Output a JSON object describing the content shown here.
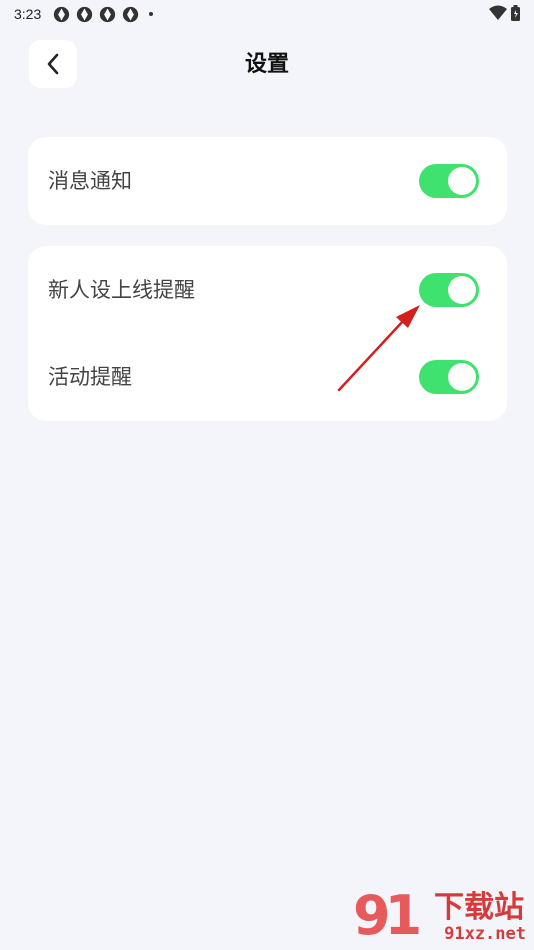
{
  "status_bar": {
    "time": "3:23"
  },
  "header": {
    "title": "设置"
  },
  "settings": [
    {
      "label": "消息通知",
      "enabled": true
    },
    {
      "label": "新人设上线提醒",
      "enabled": true
    },
    {
      "label": "活动提醒",
      "enabled": true
    }
  ],
  "colors": {
    "background": "#f4f5fa",
    "toggle_on": "#3fe26f",
    "annotation_arrow": "#d41f1f"
  },
  "watermark": {
    "brand": "下载站",
    "url": "91xz.net"
  }
}
